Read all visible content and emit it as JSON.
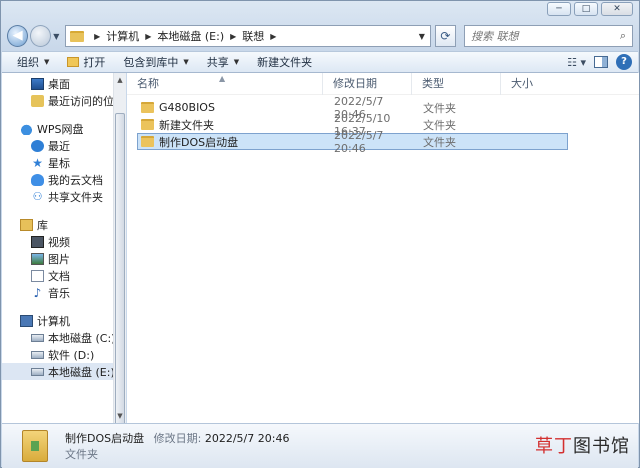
{
  "window": {
    "controls": {
      "minimize": "─",
      "maximize": "□",
      "close": "✕"
    }
  },
  "nav": {
    "breadcrumb": [
      "计算机",
      "本地磁盘 (E:)",
      "联想"
    ],
    "search_placeholder": "搜索 联想"
  },
  "toolbar": {
    "organize": "组织",
    "open": "打开",
    "include_in_library": "包含到库中",
    "share": "共享",
    "new_folder": "新建文件夹"
  },
  "sidebar": {
    "favorites": [
      {
        "label": "桌面",
        "icon": "desktop-icon"
      },
      {
        "label": "最近访问的位置",
        "icon": "recent-places-icon"
      }
    ],
    "wps": {
      "label": "WPS网盘",
      "items": [
        {
          "label": "最近",
          "icon": "clock-icon"
        },
        {
          "label": "星标",
          "icon": "star-icon"
        },
        {
          "label": "我的云文档",
          "icon": "cloud-doc-icon"
        },
        {
          "label": "共享文件夹",
          "icon": "share-icon"
        }
      ]
    },
    "libraries": {
      "label": "库",
      "items": [
        {
          "label": "视频",
          "icon": "video-icon"
        },
        {
          "label": "图片",
          "icon": "picture-icon"
        },
        {
          "label": "文档",
          "icon": "document-icon"
        },
        {
          "label": "音乐",
          "icon": "music-icon"
        }
      ]
    },
    "computer": {
      "label": "计算机",
      "items": [
        {
          "label": "本地磁盘 (C:)",
          "icon": "drive-icon"
        },
        {
          "label": "软件 (D:)",
          "icon": "drive-icon"
        },
        {
          "label": "本地磁盘 (E:)",
          "icon": "drive-icon"
        }
      ]
    }
  },
  "columns": {
    "name": "名称",
    "date": "修改日期",
    "type": "类型",
    "size": "大小"
  },
  "files": [
    {
      "name": "G480BIOS",
      "date": "2022/5/7 20:46",
      "type": "文件夹"
    },
    {
      "name": "新建文件夹",
      "date": "2022/5/10 16:37",
      "type": "文件夹"
    },
    {
      "name": "制作DOS启动盘",
      "date": "2022/5/7 20:46",
      "type": "文件夹"
    }
  ],
  "details": {
    "name": "制作DOS启动盘",
    "modified_label": "修改日期:",
    "modified_value": "2022/5/7 20:46",
    "type": "文件夹"
  },
  "watermark": {
    "part1": "草丁",
    "part2": "图书馆"
  }
}
